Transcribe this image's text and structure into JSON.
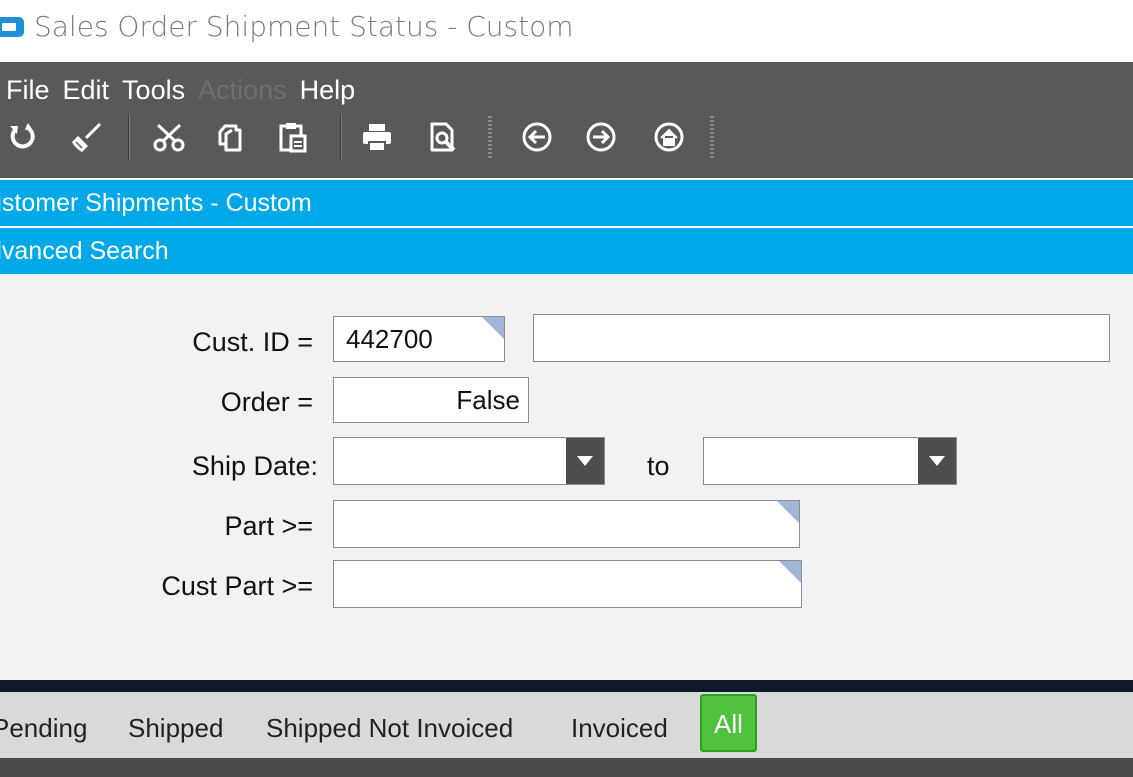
{
  "window": {
    "title": "Sales Order Shipment Status - Custom"
  },
  "menu": {
    "items": [
      {
        "label": "File",
        "enabled": true
      },
      {
        "label": "Edit",
        "enabled": true
      },
      {
        "label": "Tools",
        "enabled": true
      },
      {
        "label": "Actions",
        "enabled": false
      },
      {
        "label": "Help",
        "enabled": true
      }
    ]
  },
  "toolbar": {
    "icons": [
      "refresh-icon",
      "clear-brush-icon",
      "cut-icon",
      "copy-icon",
      "paste-icon",
      "print-icon",
      "print-preview-icon",
      "back-icon",
      "forward-icon",
      "home-icon"
    ]
  },
  "sections": {
    "main_title": "ustomer Shipments - Custom",
    "advanced_search": "dvanced Search"
  },
  "search": {
    "cust_id_label": "Cust. ID =",
    "cust_id_value": "442700",
    "cust_name_value": "",
    "order_label": "Order =",
    "order_value": "False",
    "ship_date_label": "Ship Date:",
    "ship_date_from": "",
    "to_label": "to",
    "ship_date_to": "",
    "part_label": "Part >=",
    "part_value": "",
    "cust_part_label": "Cust Part >=",
    "cust_part_value": ""
  },
  "tabs": {
    "items": [
      {
        "label": "Pending"
      },
      {
        "label": "Shipped"
      },
      {
        "label": "Shipped Not Invoiced"
      },
      {
        "label": "Invoiced"
      },
      {
        "label": "All",
        "active": true
      }
    ]
  },
  "colors": {
    "accent_blue": "#00a8e8",
    "active_tab_green": "#4fc13a",
    "toolbar_dark": "#595959"
  }
}
